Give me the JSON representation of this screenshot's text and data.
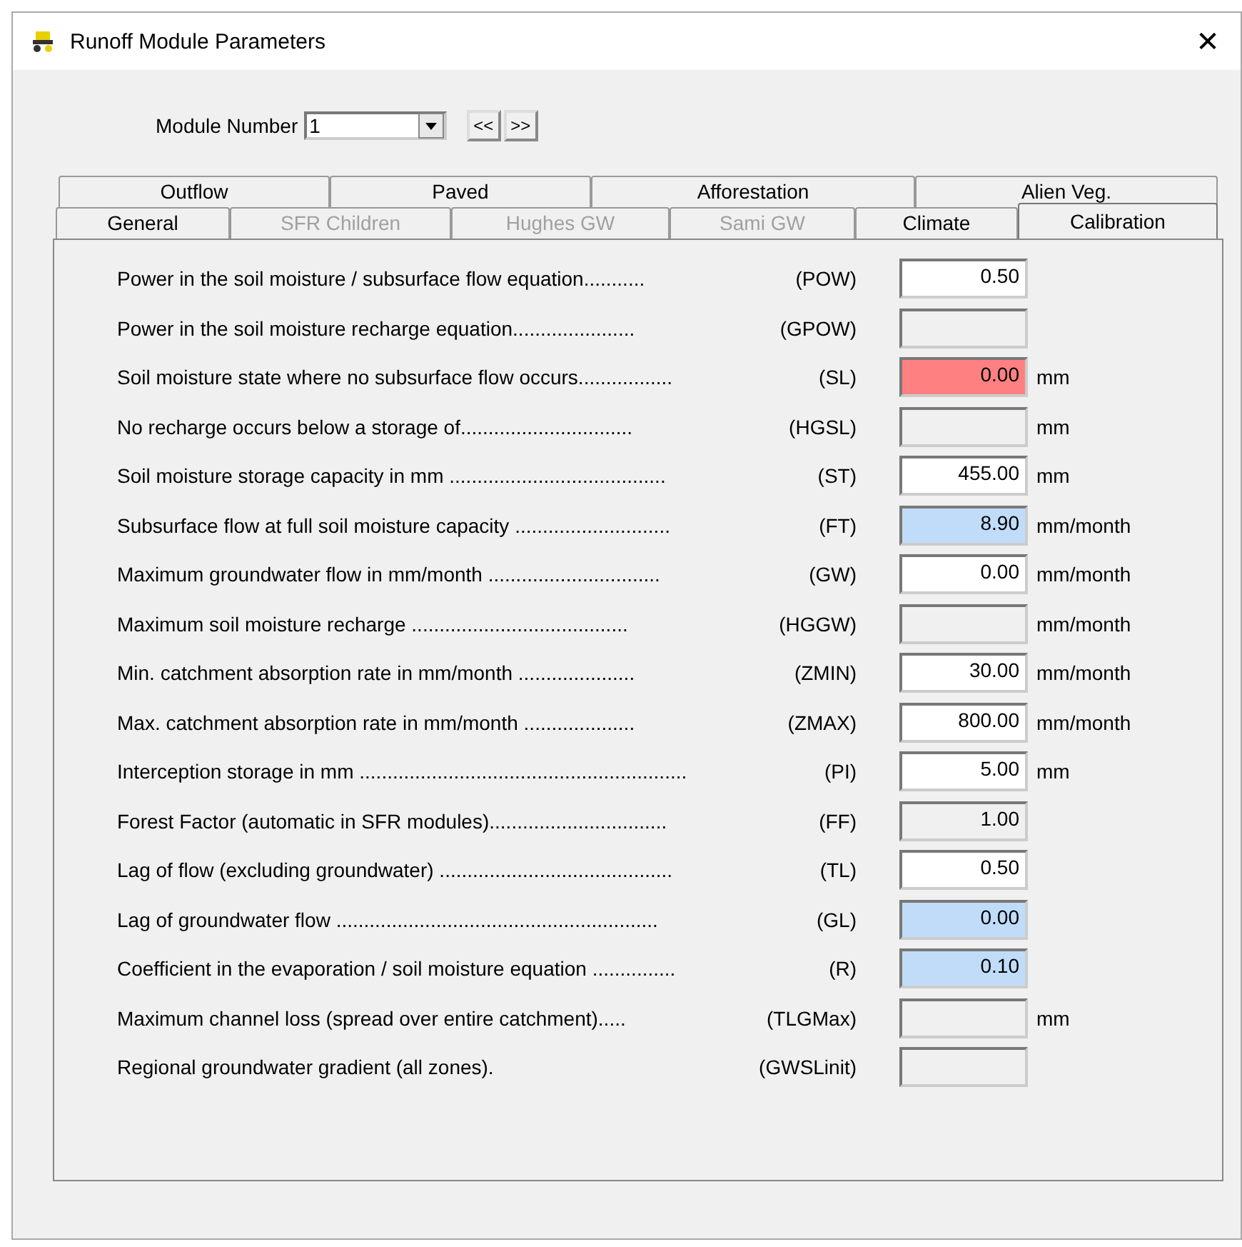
{
  "window": {
    "title": "Runoff Module Parameters",
    "close": "✕"
  },
  "module": {
    "label": "Module Number",
    "value": "1",
    "prev": "<<",
    "next": ">>"
  },
  "tab_rows": [
    {
      "tabs": [
        {
          "label": "Outflow",
          "selected": false,
          "disabled": false
        },
        {
          "label": "Paved",
          "selected": false,
          "disabled": false
        },
        {
          "label": "Afforestation",
          "selected": false,
          "disabled": false
        },
        {
          "label": "Alien Veg.",
          "selected": false,
          "disabled": false
        }
      ]
    },
    {
      "tabs": [
        {
          "label": "General",
          "selected": false,
          "disabled": false
        },
        {
          "label": "SFR Children",
          "selected": false,
          "disabled": true
        },
        {
          "label": "Hughes GW",
          "selected": false,
          "disabled": true
        },
        {
          "label": "Sami GW",
          "selected": false,
          "disabled": true
        },
        {
          "label": "Climate",
          "selected": false,
          "disabled": false
        },
        {
          "label": "Calibration",
          "selected": true,
          "disabled": false
        }
      ]
    }
  ],
  "parameters": [
    {
      "label": "Power in the soil moisture / subsurface flow equation...........",
      "code": "(POW)",
      "value": "0.50",
      "color": "#ffffff"
    },
    {
      "label": "Power in the soil moisture recharge equation......................",
      "code": "(GPOW)",
      "color": "#f0f0f0"
    },
    {
      "label": "Soil moisture state where no subsurface flow occurs.................",
      "code": "(SL)",
      "value": "0.00",
      "color": "#ff8080",
      "unit": "mm"
    },
    {
      "label": "No recharge occurs below a storage of...............................",
      "code": "(HGSL)",
      "color": "#f0f0f0",
      "unit": "mm"
    },
    {
      "label": "Soil moisture storage capacity in mm .......................................",
      "code": "(ST)",
      "value": "455.00",
      "color": "#ffffff",
      "unit": "mm"
    },
    {
      "label": "Subsurface flow at full soil moisture capacity ............................",
      "code": "(FT)",
      "value": "8.90",
      "color": "#c0dcf8",
      "unit": "mm/month"
    },
    {
      "label": "Maximum groundwater flow in mm/month ...............................",
      "code": "(GW)",
      "value": "0.00",
      "color": "#ffffff",
      "unit": "mm/month"
    },
    {
      "label": "Maximum soil moisture recharge .......................................",
      "code": "(HGGW)",
      "color": "#f0f0f0",
      "unit": "mm/month"
    },
    {
      "label": "Min. catchment absorption rate in mm/month .....................",
      "code": "(ZMIN)",
      "value": "30.00",
      "color": "#ffffff",
      "unit": "mm/month"
    },
    {
      "label": "Max. catchment absorption rate in mm/month ....................",
      "code": "(ZMAX)",
      "value": "800.00",
      "color": "#ffffff",
      "unit": "mm/month"
    },
    {
      "label": "Interception storage in mm ...........................................................",
      "code": "(PI)",
      "value": "5.00",
      "color": "#ffffff",
      "unit": "mm"
    },
    {
      "label": "Forest Factor (automatic in SFR modules)................................",
      "code": "(FF)",
      "value": "1.00",
      "color": "#f0f0f0"
    },
    {
      "label": "Lag of flow (excluding groundwater) ..........................................",
      "code": "(TL)",
      "value": "0.50",
      "color": "#ffffff"
    },
    {
      "label": "Lag of groundwater flow ..........................................................",
      "code": "(GL)",
      "value": "0.00",
      "color": "#c0dcf8"
    },
    {
      "label": "Coefficient in the evaporation / soil moisture equation ...............",
      "code": "(R)",
      "value": "0.10",
      "color": "#c0dcf8"
    },
    {
      "label": "Maximum channel loss (spread over entire catchment).....",
      "code": "(TLGMax)",
      "color": "#f0f0f0",
      "unit": "mm"
    },
    {
      "label": "Regional groundwater gradient (all zones).",
      "code": "(GWSLinit)",
      "color": "#f0f0f0"
    }
  ]
}
